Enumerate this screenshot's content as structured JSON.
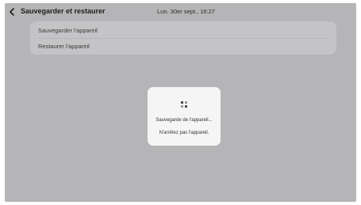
{
  "header": {
    "title": "Sauvegarder et restaurer",
    "clock": "Lun. 30er sept., 16:27",
    "back_icon": "chevron-left-icon"
  },
  "menu": {
    "items": [
      {
        "label": "Sauvegarder l'appareil"
      },
      {
        "label": "Restaurer l'appareil"
      }
    ]
  },
  "dialog": {
    "icon": "backup-progress-icon",
    "message": "Sauvegarde de l'appareil...",
    "warning": "N'arrêtez pas l'appareil."
  },
  "colors": {
    "screen_background": "#b5b5b7",
    "card_background": "#c4c4c6",
    "dialog_background": "#f5f5f6",
    "text_primary": "#1e1e1e"
  }
}
